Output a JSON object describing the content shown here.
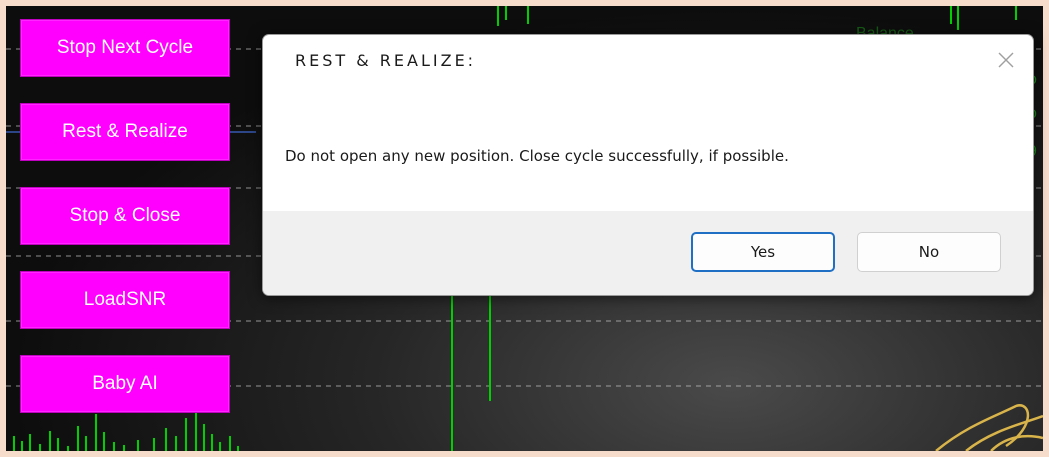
{
  "side_buttons": [
    {
      "label": "Stop Next Cycle"
    },
    {
      "label": "Rest & Realize"
    },
    {
      "label": "Stop & Close"
    },
    {
      "label": "LoadSNR"
    },
    {
      "label": "Baby AI"
    }
  ],
  "dialog": {
    "title": "REST & REALIZE:",
    "message": "Do not open any new position. Close cycle successfully, if possible.",
    "yes_label": "Yes",
    "no_label": "No",
    "close_icon": "close-icon"
  },
  "colors": {
    "side_button_bg": "#ff00ff",
    "chart_line": "#00d000",
    "primary_border": "#1f6fc4",
    "frame": "#f6dccb"
  }
}
